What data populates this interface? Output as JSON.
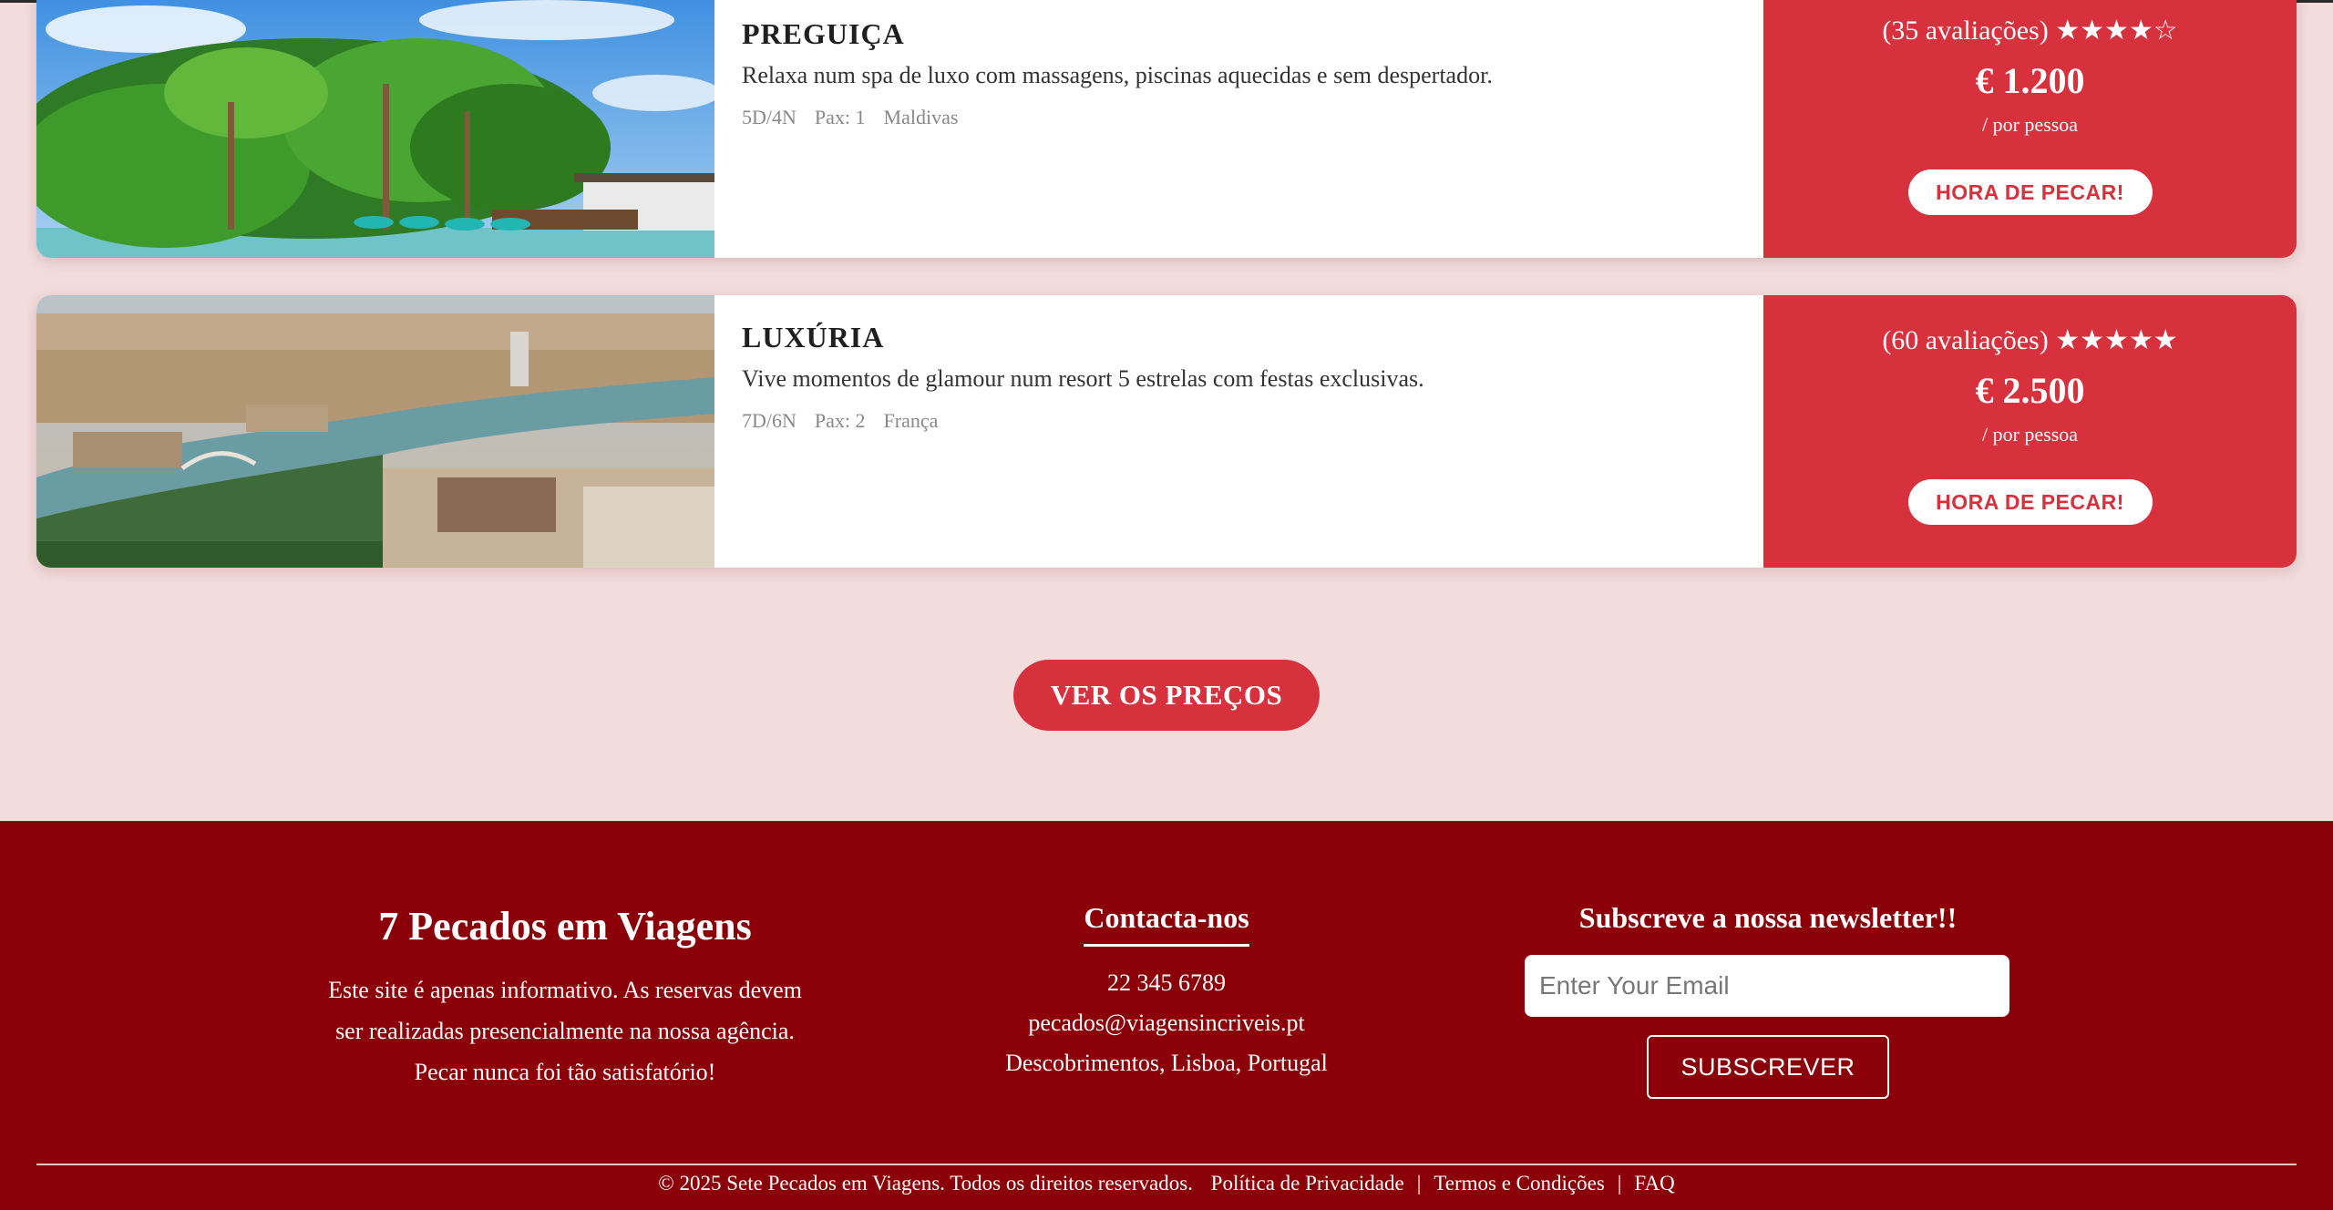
{
  "packages": [
    {
      "title": "PREGUIÇA",
      "description": "Relaxa num spa de luxo com massagens, piscinas aquecidas e sem despertador.",
      "duration": "5D/4N",
      "pax": "Pax: 1",
      "destination": "Maldivas",
      "rating_text": "(35 avaliações) ★★★★☆",
      "rating": 4,
      "reviews": 35,
      "price": "€ 1.200",
      "per": "/ por pessoa",
      "button": "HORA DE PECAR!"
    },
    {
      "title": "LUXÚRIA",
      "description": "Vive momentos de glamour num resort 5 estrelas com festas exclusivas.",
      "duration": "7D/6N",
      "pax": "Pax: 2",
      "destination": "França",
      "rating_text": "(60 avaliações) ★★★★★",
      "rating": 5,
      "reviews": 60,
      "price": "€ 2.500",
      "per": "/ por pessoa",
      "button": "HORA DE PECAR!"
    }
  ],
  "main": {
    "prices_button": "VER OS PREÇOS"
  },
  "footer": {
    "brand": "7 Pecados em Viagens",
    "brand_text_1": "Este site é apenas informativo. As reservas devem",
    "brand_text_2": "ser realizadas presencialmente na nossa agência.",
    "brand_text_3": "Pecar nunca foi tão satisfatório!",
    "contact_title": "Contacta-nos",
    "phone": "22 345 6789",
    "email": "pecados@viagensincriveis.pt",
    "address": "Descobrimentos, Lisboa, Portugal",
    "newsletter_title": "Subscreve a nossa newsletter!!",
    "email_placeholder": "Enter Your Email",
    "subscribe": "SUBSCREVER",
    "copyright": "© 2025 Sete Pecados em Viagens. Todos os direitos reservados.",
    "privacy": "Política de Privacidade",
    "terms": "Termos e Condições",
    "faq": "FAQ",
    "separator": "|"
  },
  "colors": {
    "accent": "#d6313c",
    "footer": "#8b0008",
    "background": "#f2dcdc"
  }
}
